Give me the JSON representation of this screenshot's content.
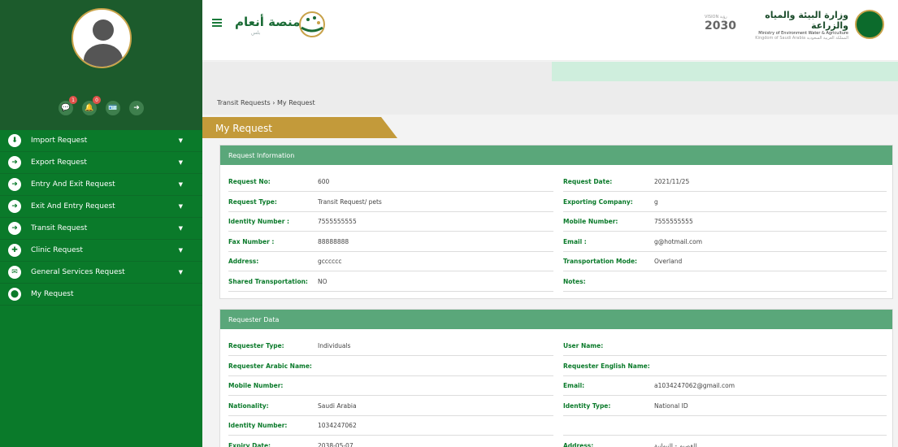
{
  "sidebar": {
    "quick": [
      {
        "icon": "💬",
        "badge": "1"
      },
      {
        "icon": "🔔",
        "badge": "0"
      },
      {
        "icon": "🪪",
        "badge": ""
      },
      {
        "icon": "➜",
        "badge": ""
      }
    ],
    "items": [
      {
        "label": "Import Request",
        "icon": "⬇",
        "chev": "▼"
      },
      {
        "label": "Export Request",
        "icon": "➜",
        "chev": "▼"
      },
      {
        "label": "Entry And Exit Request",
        "icon": "➜",
        "chev": "▼"
      },
      {
        "label": "Exit And Entry Request",
        "icon": "➜",
        "chev": "▼"
      },
      {
        "label": "Transit Request",
        "icon": "➜",
        "chev": "▼"
      },
      {
        "label": "Clinic Request",
        "icon": "✚",
        "chev": "▼"
      },
      {
        "label": "General Services Request",
        "icon": "✉",
        "chev": "▼"
      },
      {
        "label": "My Request",
        "icon": "⬤",
        "chev": ""
      }
    ]
  },
  "header": {
    "logo_ar": "منصة أنعام",
    "logo_sub": "بلس",
    "vision": "2030",
    "vision_small": "VISION رؤية",
    "ministry_ar": "وزارة البيئة والمياه والزراعة",
    "ministry_en": "Ministry of Environment Water & Agriculture",
    "ministry_ks": "Kingdom of Saudi Arabia المملكة العربية السعودية"
  },
  "breadcrumb": {
    "parent": "Transit Requests",
    "sep": "›",
    "current": "My Request"
  },
  "page_title": "My Request",
  "request_info": {
    "title": "Request Information",
    "rows": [
      {
        "l1": "Request No:",
        "v1": "600",
        "l2": "Request Date:",
        "v2": "2021/11/25"
      },
      {
        "l1": "Request Type:",
        "v1": "Transit Request/ pets",
        "l2": "Exporting Company:",
        "v2": "g"
      },
      {
        "l1": "Identity Number :",
        "v1": "7555555555",
        "l2": "Mobile Number:",
        "v2": "7555555555"
      },
      {
        "l1": "Fax Number :",
        "v1": "88888888",
        "l2": "Email :",
        "v2": "g@hotmail.com"
      },
      {
        "l1": "Address:",
        "v1": "gcccccc",
        "l2": "Transportation Mode:",
        "v2": "Overland"
      },
      {
        "l1": "Shared Transportation:",
        "v1": "NO",
        "l2": "Notes:",
        "v2": ""
      }
    ]
  },
  "requester": {
    "title": "Requester Data",
    "rows": [
      {
        "l1": "Requester Type:",
        "v1": "Individuals",
        "l2": "User Name:",
        "v2": ""
      },
      {
        "l1": "Requester Arabic Name:",
        "v1": "",
        "l2": "Requester English Name:",
        "v2": ""
      },
      {
        "l1": "Mobile Number:",
        "v1": "",
        "l2": "Email:",
        "v2": "a1034247062@gmail.com"
      },
      {
        "l1": "Nationality:",
        "v1": "Saudi Arabia",
        "l2": "Identity Type:",
        "v2": "National ID"
      },
      {
        "l1": "Identity Number:",
        "v1": "1034247062",
        "l2": "",
        "v2": ""
      },
      {
        "l1": "Expiry Date:",
        "v1": "2038-05-07",
        "l2": "Address:",
        "v2": "القصيم - النبهانية"
      }
    ]
  }
}
